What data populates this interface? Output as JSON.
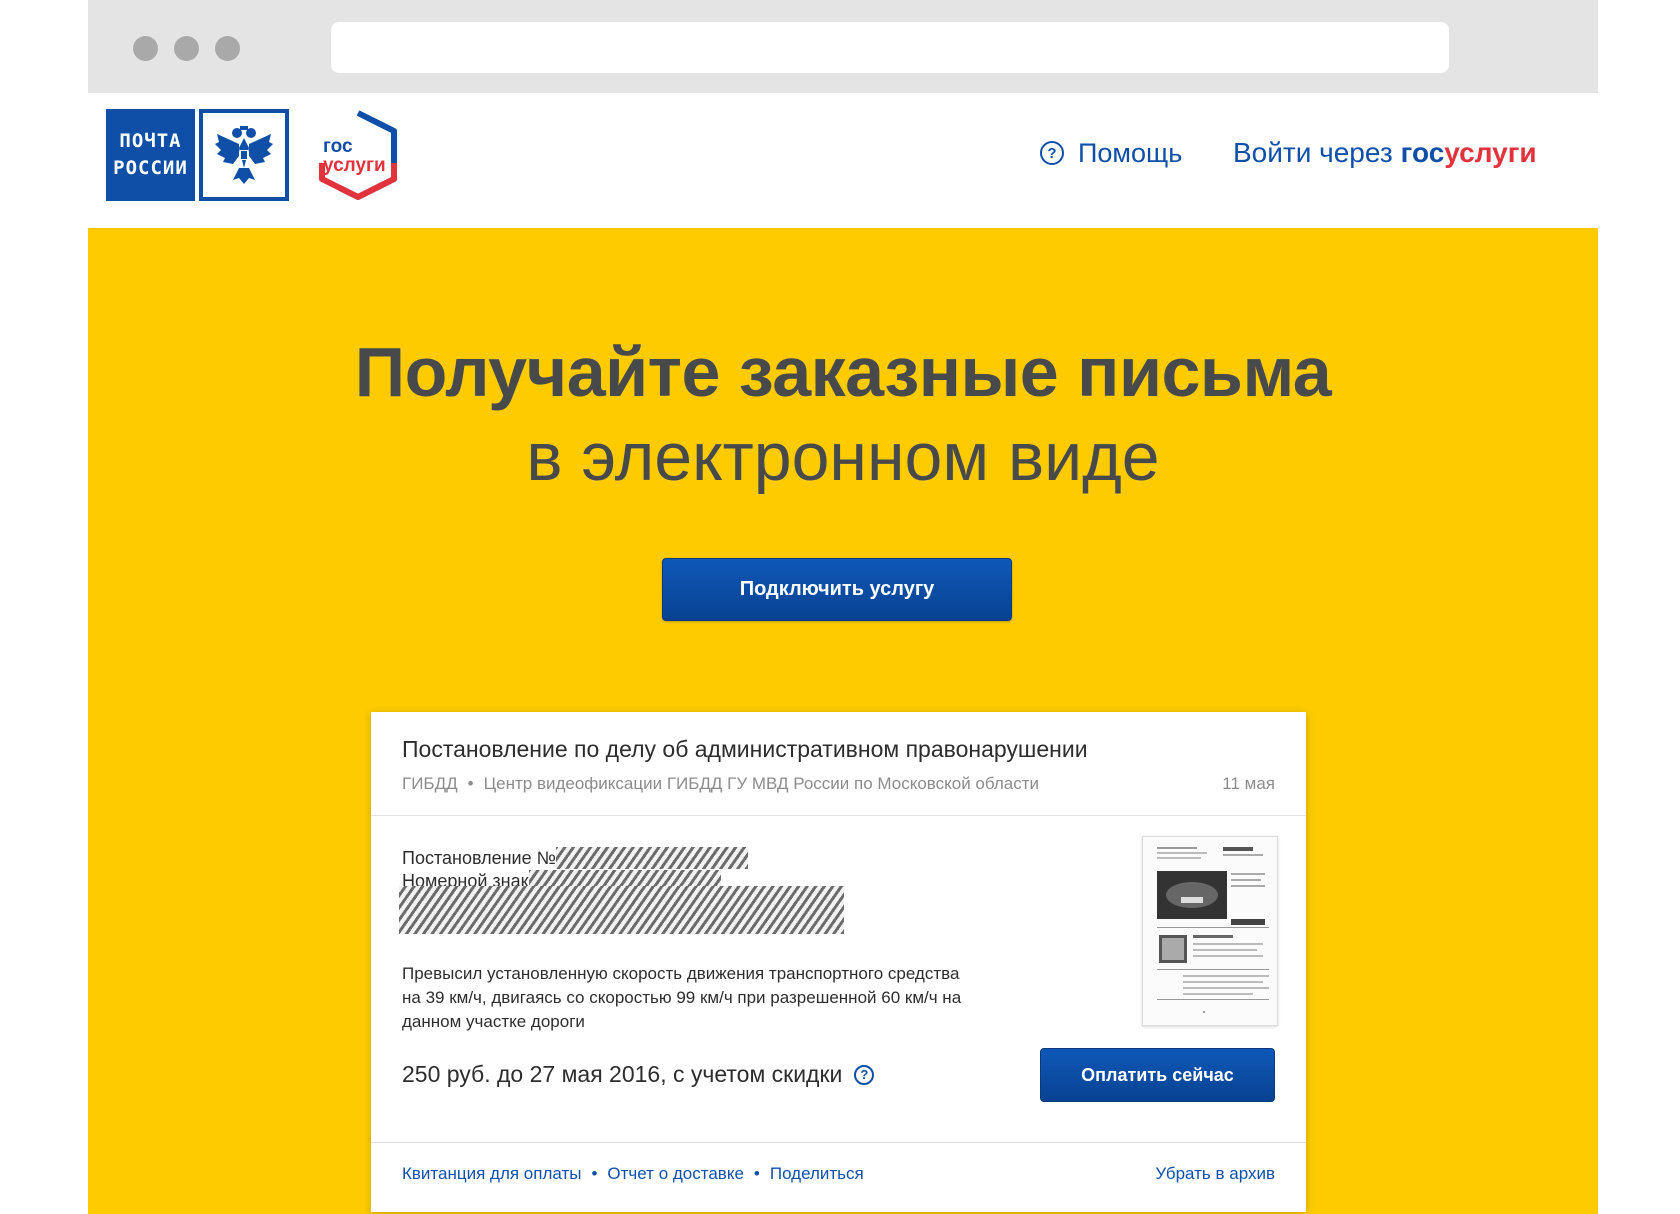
{
  "header": {
    "pochta_logo": {
      "line1": "ПОЧТА",
      "line2": "РОССИИ"
    },
    "gos_logo": {
      "line1": "гос",
      "line2": "услуги"
    },
    "help_label": "Помощь",
    "login_prefix": "Войти через",
    "login_brand_gos": "гос",
    "login_brand_uslugi": "услуги"
  },
  "hero": {
    "title": "Получайте заказные письма",
    "subtitle": "в электронном виде",
    "cta_label": "Подключить услугу"
  },
  "card": {
    "title": "Постановление по делу об административном правонарушении",
    "sender": "ГИБДД",
    "sender_detail": "Центр видеофиксации ГИБДД ГУ МВД России по Московской области",
    "date": "11 мая",
    "field_decree_label": "Постановление №",
    "field_plate_label": "Номерной знак",
    "violation_text": "Превысил установленную скорость движения транспортного средства на 39 км/ч, двигаясь со скоростью 99 км/ч при разрешенной 60 км/ч на данном участке дороги",
    "amount_text": "250 руб. до 27 мая 2016, с учетом скидки",
    "pay_label": "Оплатить сейчас",
    "links": [
      "Квитанция для оплаты",
      "Отчет о доставке",
      "Поделиться"
    ],
    "archive_label": "Убрать в архив"
  },
  "colors": {
    "brand_blue": "#0f4fa8",
    "brand_red": "#e2333d",
    "hero_yellow": "#fdcb00"
  }
}
